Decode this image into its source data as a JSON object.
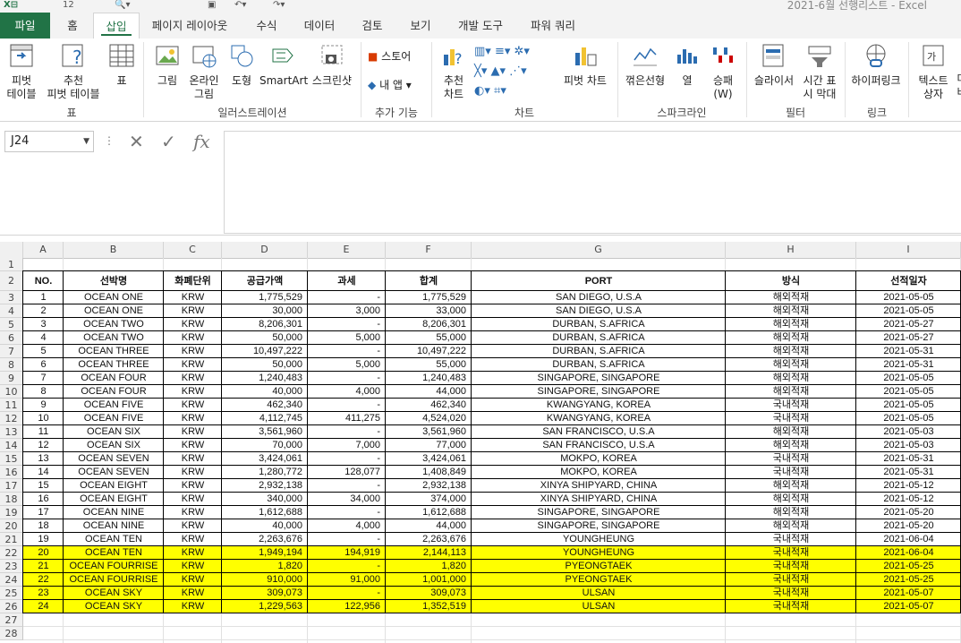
{
  "window": {
    "title": "2021-6월 선행리스트 - Excel",
    "qat_zoom": "12"
  },
  "ribbon_tabs": [
    "파일",
    "홈",
    "삽입",
    "페이지 레이아웃",
    "수식",
    "데이터",
    "검토",
    "보기",
    "개발 도구",
    "파워 쿼리"
  ],
  "active_tab": "삽입",
  "ribbon": {
    "table_group": {
      "label": "표",
      "pivot": "피벗\n테이블",
      "rec_pivot": "추천\n피벗 테이블",
      "table": "표"
    },
    "illust_group": {
      "label": "일러스트레이션",
      "picture": "그림",
      "online_picture": "온라인\n그림",
      "shapes": "도형",
      "smartart": "SmartArt",
      "screenshot": "스크린샷"
    },
    "addin_group": {
      "label": "추가 기능",
      "store": "스토어",
      "my_apps": "내 앱"
    },
    "chart_group": {
      "label": "차트",
      "rec_charts": "추천\n차트",
      "pivot_chart": "피벗 차트"
    },
    "spark_group": {
      "label": "스파크라인",
      "line": "꺾은선형",
      "column": "열",
      "winloss": "승패\n(W)"
    },
    "filter_group": {
      "label": "필터",
      "slicer": "슬라이서",
      "timeline": "시간 표\n시 막대"
    },
    "link_group": {
      "label": "링크",
      "hyperlink": "하이퍼링크"
    },
    "text_group": {
      "textbox": "텍스트\n상자",
      "more": "머\n바"
    }
  },
  "formula_bar": {
    "name_box": "J24",
    "formula": ""
  },
  "columns": [
    "A",
    "B",
    "C",
    "D",
    "E",
    "F",
    "G",
    "H",
    "I"
  ],
  "header_row": [
    "NO.",
    "선박명",
    "화폐단위",
    "공급가액",
    "과세",
    "합계",
    "PORT",
    "방식",
    "선적일자"
  ],
  "rows": [
    [
      "1",
      "OCEAN ONE",
      "KRW",
      "1,775,529",
      "-",
      "1,775,529",
      "SAN DIEGO, U.S.A",
      "해외적재",
      "2021-05-05"
    ],
    [
      "2",
      "OCEAN ONE",
      "KRW",
      "30,000",
      "3,000",
      "33,000",
      "SAN DIEGO, U.S.A",
      "해외적재",
      "2021-05-05"
    ],
    [
      "3",
      "OCEAN TWO",
      "KRW",
      "8,206,301",
      "-",
      "8,206,301",
      "DURBAN, S.AFRICA",
      "해외적재",
      "2021-05-27"
    ],
    [
      "4",
      "OCEAN TWO",
      "KRW",
      "50,000",
      "5,000",
      "55,000",
      "DURBAN, S.AFRICA",
      "해외적재",
      "2021-05-27"
    ],
    [
      "5",
      "OCEAN THREE",
      "KRW",
      "10,497,222",
      "-",
      "10,497,222",
      "DURBAN, S.AFRICA",
      "해외적재",
      "2021-05-31"
    ],
    [
      "6",
      "OCEAN THREE",
      "KRW",
      "50,000",
      "5,000",
      "55,000",
      "DURBAN, S.AFRICA",
      "해외적재",
      "2021-05-31"
    ],
    [
      "7",
      "OCEAN FOUR",
      "KRW",
      "1,240,483",
      "-",
      "1,240,483",
      "SINGAPORE, SINGAPORE",
      "해외적재",
      "2021-05-05"
    ],
    [
      "8",
      "OCEAN FOUR",
      "KRW",
      "40,000",
      "4,000",
      "44,000",
      "SINGAPORE, SINGAPORE",
      "해외적재",
      "2021-05-05"
    ],
    [
      "9",
      "OCEAN FIVE",
      "KRW",
      "462,340",
      "-",
      "462,340",
      "KWANGYANG, KOREA",
      "국내적재",
      "2021-05-05"
    ],
    [
      "10",
      "OCEAN FIVE",
      "KRW",
      "4,112,745",
      "411,275",
      "4,524,020",
      "KWANGYANG, KOREA",
      "국내적재",
      "2021-05-05"
    ],
    [
      "11",
      "OCEAN SIX",
      "KRW",
      "3,561,960",
      "-",
      "3,561,960",
      "SAN FRANCISCO, U.S.A",
      "해외적재",
      "2021-05-03"
    ],
    [
      "12",
      "OCEAN SIX",
      "KRW",
      "70,000",
      "7,000",
      "77,000",
      "SAN FRANCISCO, U.S.A",
      "해외적재",
      "2021-05-03"
    ],
    [
      "13",
      "OCEAN SEVEN",
      "KRW",
      "3,424,061",
      "-",
      "3,424,061",
      "MOKPO, KOREA",
      "국내적재",
      "2021-05-31"
    ],
    [
      "14",
      "OCEAN SEVEN",
      "KRW",
      "1,280,772",
      "128,077",
      "1,408,849",
      "MOKPO, KOREA",
      "국내적재",
      "2021-05-31"
    ],
    [
      "15",
      "OCEAN EIGHT",
      "KRW",
      "2,932,138",
      "-",
      "2,932,138",
      "XINYA SHIPYARD, CHINA",
      "해외적재",
      "2021-05-12"
    ],
    [
      "16",
      "OCEAN EIGHT",
      "KRW",
      "340,000",
      "34,000",
      "374,000",
      "XINYA SHIPYARD, CHINA",
      "해외적재",
      "2021-05-12"
    ],
    [
      "17",
      "OCEAN NINE",
      "KRW",
      "1,612,688",
      "-",
      "1,612,688",
      "SINGAPORE, SINGAPORE",
      "해외적재",
      "2021-05-20"
    ],
    [
      "18",
      "OCEAN NINE",
      "KRW",
      "40,000",
      "4,000",
      "44,000",
      "SINGAPORE, SINGAPORE",
      "해외적재",
      "2021-05-20"
    ],
    [
      "19",
      "OCEAN TEN",
      "KRW",
      "2,263,676",
      "-",
      "2,263,676",
      "YOUNGHEUNG",
      "국내적재",
      "2021-06-04"
    ],
    [
      "20",
      "OCEAN TEN",
      "KRW",
      "1,949,194",
      "194,919",
      "2,144,113",
      "YOUNGHEUNG",
      "국내적재",
      "2021-06-04"
    ],
    [
      "21",
      "OCEAN FOURRISE",
      "KRW",
      "1,820",
      "-",
      "1,820",
      "PYEONGTAEK",
      "국내적재",
      "2021-05-25"
    ],
    [
      "22",
      "OCEAN FOURRISE",
      "KRW",
      "910,000",
      "91,000",
      "1,001,000",
      "PYEONGTAEK",
      "국내적재",
      "2021-05-25"
    ],
    [
      "23",
      "OCEAN SKY",
      "KRW",
      "309,073",
      "-",
      "309,073",
      "ULSAN",
      "국내적재",
      "2021-05-07"
    ],
    [
      "24",
      "OCEAN SKY",
      "KRW",
      "1,229,563",
      "122,956",
      "1,352,519",
      "ULSAN",
      "국내적재",
      "2021-05-07"
    ]
  ],
  "highlighted_from_no": 20,
  "colors": {
    "excel_green": "#217346",
    "highlight": "#ffff00"
  }
}
